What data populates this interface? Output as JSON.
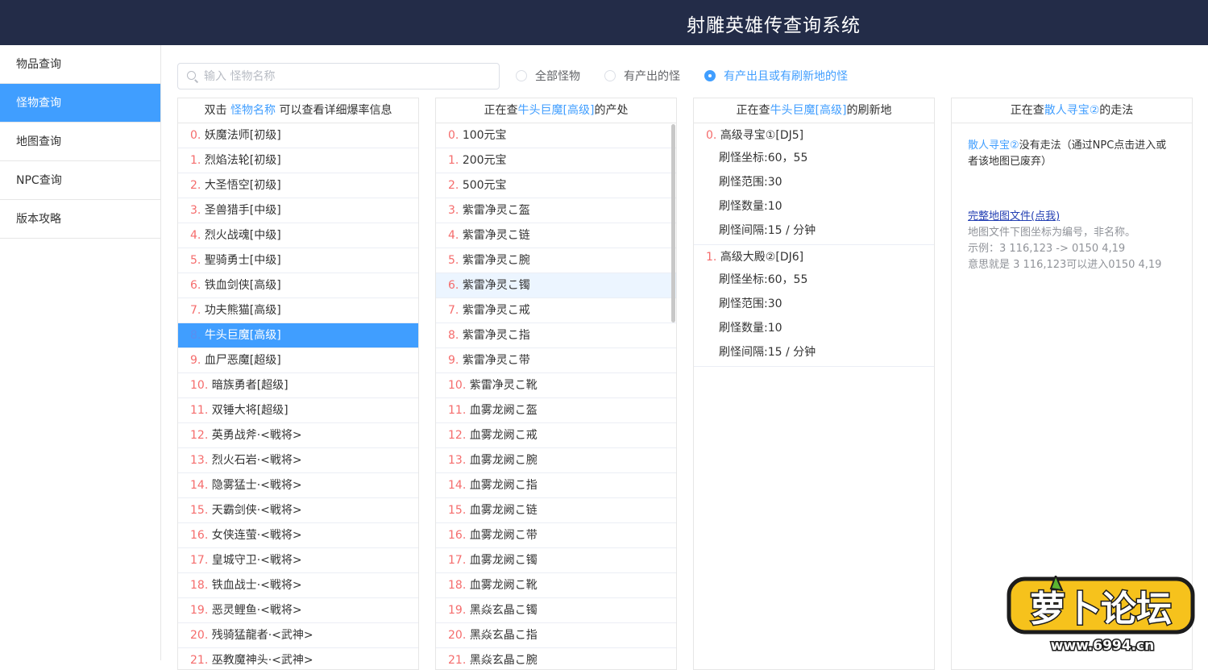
{
  "app": {
    "title": "射雕英雄传查询系统"
  },
  "sidebar": {
    "items": [
      {
        "label": "物品查询"
      },
      {
        "label": "怪物查询"
      },
      {
        "label": "地图查询"
      },
      {
        "label": "NPC查询"
      },
      {
        "label": "版本攻略"
      }
    ],
    "active_index": 1
  },
  "search": {
    "placeholder": "输入 怪物名称",
    "value": ""
  },
  "filters": [
    {
      "label": "全部怪物",
      "checked": false
    },
    {
      "label": "有产出的怪",
      "checked": false
    },
    {
      "label": "有产出且或有刷新地的怪",
      "checked": true
    }
  ],
  "monsters_panel": {
    "head": {
      "pre": "双击 ",
      "highlight": "怪物名称",
      "post": " 可以查看详细爆率信息"
    },
    "selected_index": 8,
    "rows": [
      "妖魔法师[初级]",
      "烈焰法轮[初级]",
      "大圣悟空[初级]",
      "圣兽猎手[中级]",
      "烈火战魂[中级]",
      "聖骑勇士[中级]",
      "铁血剑侠[高级]",
      "功夫熊猫[高级]",
      "牛头巨魔[高级]",
      "血尸恶魔[超级]",
      "暗族勇者[超级]",
      "双锤大将[超级]",
      "英勇战斧·<戦将>",
      "烈火石岩·<戦将>",
      "隐雾猛士·<戦将>",
      "天霸剑侠·<戦将>",
      "女侠连萤·<戦将>",
      "皇城守卫·<戦将>",
      "铁血战士·<戦将>",
      "恶灵鲤鱼·<戦将>",
      "残骑猛龍者·<武神>",
      "巫教魔神头·<武神>"
    ]
  },
  "drops_panel": {
    "head": {
      "pre": "正在查",
      "highlight": "牛头巨魔[高级]",
      "post": "的产处"
    },
    "hover_index": 6,
    "rows": [
      "100元宝",
      "200元宝",
      "500元宝",
      "紫雷净灵こ盔",
      "紫雷净灵こ链",
      "紫雷净灵こ腕",
      "紫雷净灵こ镯",
      "紫雷净灵こ戒",
      "紫雷净灵こ指",
      "紫雷净灵こ带",
      "紫雷净灵こ靴",
      "血雾龙阙こ盔",
      "血雾龙阙こ戒",
      "血雾龙阙こ腕",
      "血雾龙阙こ指",
      "血雾龙阙こ链",
      "血雾龙阙こ带",
      "血雾龙阙こ镯",
      "血雾龙阙こ靴",
      "黑焱玄晶こ镯",
      "黑焱玄晶こ指",
      "黑焱玄晶こ腕"
    ]
  },
  "spawn_panel": {
    "head": {
      "pre": "正在查",
      "highlight": "牛头巨魔[高级]",
      "post": "的刷新地"
    },
    "blocks": [
      {
        "idx": "0.",
        "name": "高级寻宝①[DJ5]",
        "coord_label": "刷怪坐标:",
        "coord": "60，55",
        "range_label": "刷怪范围:",
        "range": "30",
        "count_label": "刷怪数量:",
        "count": "10",
        "interval_label": "刷怪间隔:",
        "interval": "15 / 分钟"
      },
      {
        "idx": "1.",
        "name": "高级大殿②[DJ6]",
        "coord_label": "刷怪坐标:",
        "coord": "60，55",
        "range_label": "刷怪范围:",
        "range": "30",
        "count_label": "刷怪数量:",
        "count": "10",
        "interval_label": "刷怪间隔:",
        "interval": "15 / 分钟"
      }
    ]
  },
  "method_panel": {
    "head": {
      "pre": "正在查",
      "highlight": "散人寻宝②",
      "post": "的走法"
    },
    "map_name": "散人寻宝②",
    "text": "没有走法（通过NPC点击进入或者该地图已废弃）",
    "link": "完整地图文件(点我)",
    "notes": [
      "地图文件下图坐标为编号，非名称。",
      "示例：3 116,123 -> 0150 4,19",
      "意思就是 3 116,123可以进入0150 4,19"
    ]
  },
  "watermark": {
    "logo_text": "萝卜论坛",
    "url": "www.6994.cn"
  },
  "colors": {
    "header": "#232c48",
    "accent": "#409eff",
    "index": "#f56c6c",
    "link": "#2440b3"
  }
}
